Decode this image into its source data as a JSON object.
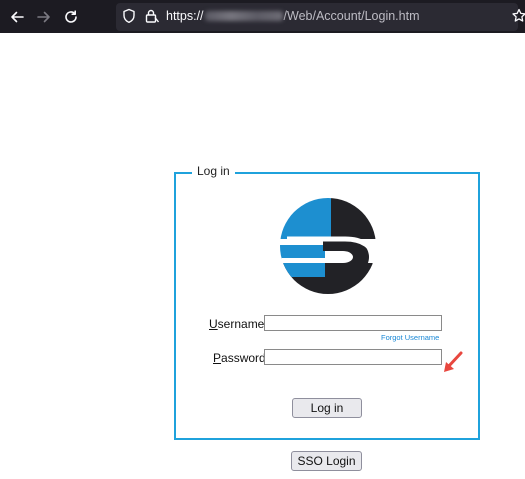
{
  "browser": {
    "url_prefix": "https://",
    "url_path": "/Web/Account/Login.htm",
    "icons": [
      "back-arrow-icon",
      "forward-arrow-icon",
      "reload-icon",
      "shield-icon",
      "lock-icon",
      "star-icon"
    ]
  },
  "login": {
    "legend": "Log in",
    "username_label_key": "U",
    "username_label_rest": "sername:",
    "password_label_key": "P",
    "password_label_rest": "assword:",
    "username_value": "",
    "password_value": "",
    "forgot_username": "Forgot Username",
    "login_button": "Log in"
  },
  "sso": {
    "button": "SSO Login"
  },
  "colors": {
    "browser_bg": "#1c1b22",
    "urlbar_bg": "#2b2a33",
    "frame_border": "#1fa2dc",
    "logo_blue": "#1d8fd0",
    "logo_dark": "#222226",
    "link": "#1a88d6",
    "annotation_arrow": "#e8473f"
  }
}
